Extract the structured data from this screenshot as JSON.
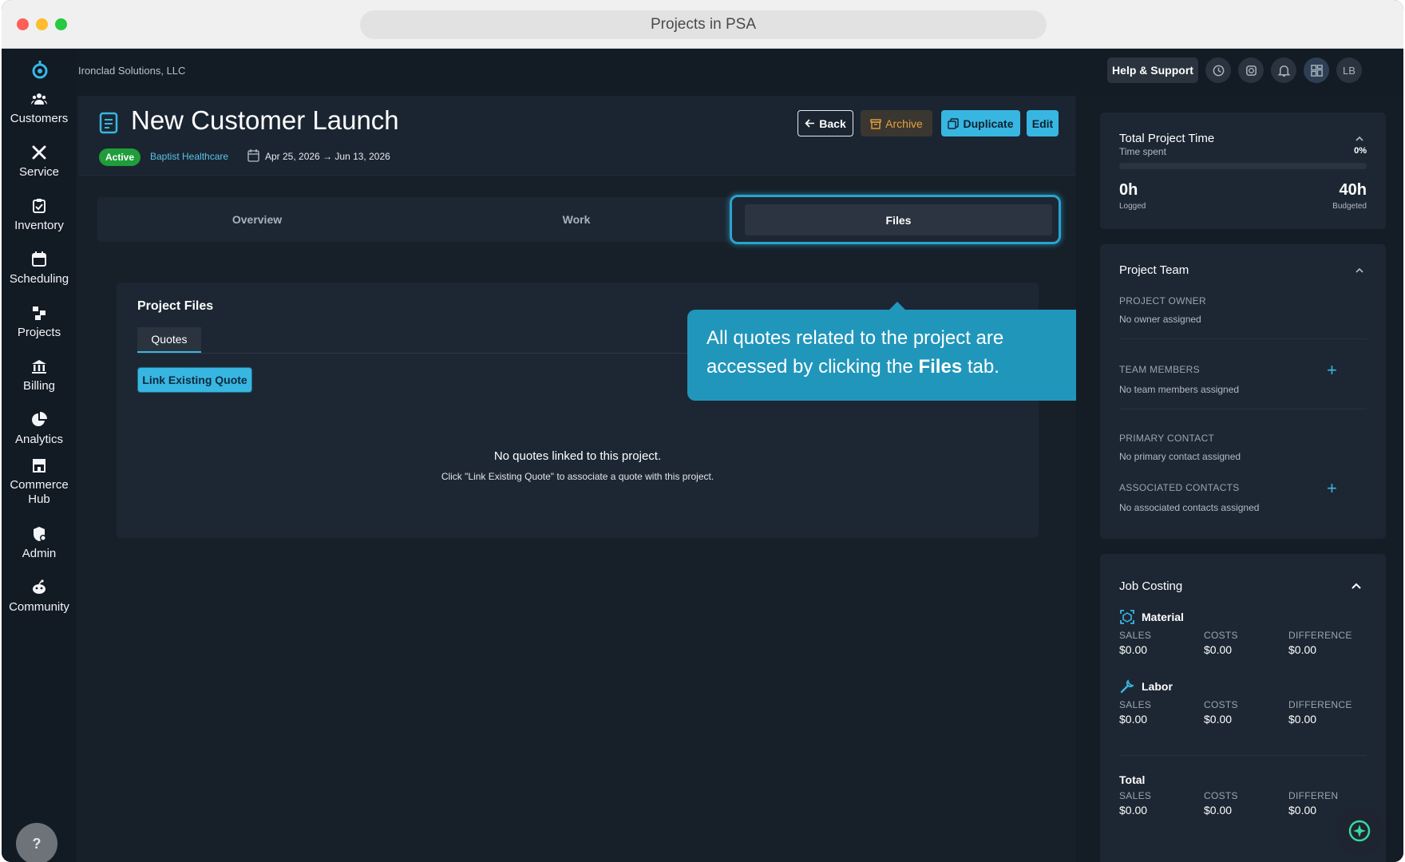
{
  "browser": {
    "url_title": "Projects in PSA"
  },
  "topbar": {
    "company": "Ironclad Solutions, LLC",
    "help_label": "Help & Support",
    "avatar_initials": "LB",
    "icons": [
      "history-icon",
      "timer-icon",
      "bell-icon",
      "dashboard-icon"
    ]
  },
  "sidebar": {
    "items": [
      {
        "label": "Customers",
        "icon": "customers-icon"
      },
      {
        "label": "Service",
        "icon": "service-icon"
      },
      {
        "label": "Inventory",
        "icon": "inventory-icon"
      },
      {
        "label": "Scheduling",
        "icon": "calendar-icon"
      },
      {
        "label": "Projects",
        "icon": "projects-icon"
      },
      {
        "label": "Billing",
        "icon": "bank-icon"
      },
      {
        "label": "Analytics",
        "icon": "pie-chart-icon"
      },
      {
        "label": "Commerce Hub",
        "icon": "store-icon"
      },
      {
        "label": "Admin",
        "icon": "admin-shield-icon"
      },
      {
        "label": "Community",
        "icon": "community-icon"
      }
    ],
    "help_button": "?"
  },
  "project": {
    "title": "New Customer Launch",
    "status": "Active",
    "customer": "Baptist Healthcare",
    "start_date": "Apr 25, 2026",
    "arrow": "→",
    "end_date": "Jun 13, 2026"
  },
  "actions": {
    "back": "Back",
    "archive": "Archive",
    "duplicate": "Duplicate",
    "edit": "Edit"
  },
  "tabs": {
    "overview": "Overview",
    "work": "Work",
    "files": "Files"
  },
  "files_panel": {
    "title": "Project Files",
    "subtab": "Quotes",
    "link_button": "Link Existing Quote",
    "empty_title": "No quotes linked to this project.",
    "empty_hint": "Click \"Link Existing Quote\" to associate a quote with this project."
  },
  "tooltip": {
    "text_before": "All quotes related to the project are accessed by clicking the ",
    "text_bold": "Files",
    "text_after": " tab."
  },
  "time_card": {
    "title": "Total Project Time",
    "subtitle": "Time spent",
    "percent": "0%",
    "progress_fraction": 0.0,
    "logged_value": "0h",
    "logged_label": "Logged",
    "budget_value": "40h",
    "budget_label": "Budgeted"
  },
  "team_card": {
    "title": "Project Team",
    "owner_label": "PROJECT OWNER",
    "owner_value": "No owner assigned",
    "members_label": "TEAM MEMBERS",
    "members_value": "No team members assigned",
    "primary_label": "PRIMARY CONTACT",
    "primary_value": "No primary contact assigned",
    "associated_label": "ASSOCIATED CONTACTS",
    "associated_value": "No associated contacts assigned"
  },
  "job_costing": {
    "title": "Job Costing",
    "col_sales": "SALES",
    "col_costs": "COSTS",
    "col_difference": "DIFFERENCE",
    "col_difference_truncated": "DIFFEREN",
    "material": {
      "label": "Material",
      "sales": "$0.00",
      "costs": "$0.00",
      "difference": "$0.00"
    },
    "labor": {
      "label": "Labor",
      "sales": "$0.00",
      "costs": "$0.00",
      "difference": "$0.00"
    },
    "total": {
      "label": "Total",
      "sales": "$0.00",
      "costs": "$0.00",
      "difference": "$0.00"
    }
  },
  "colors": {
    "accent": "#38b6e2",
    "active_badge": "#1f9d3a",
    "archive": "#e9a13b",
    "tooltip": "#2196bb"
  }
}
